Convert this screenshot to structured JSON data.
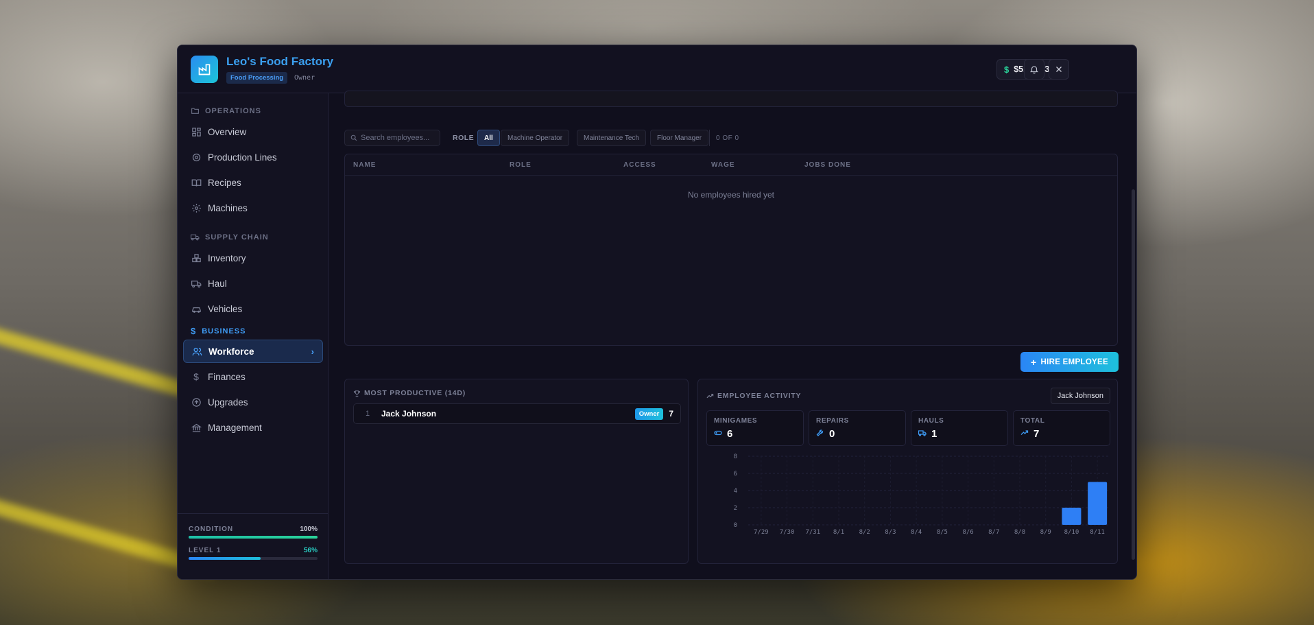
{
  "header": {
    "title": "Leo's Food Factory",
    "category": "Food Processing",
    "role": "Owner",
    "balance": "$514,433"
  },
  "sidebar": {
    "sections": [
      {
        "label": "OPERATIONS",
        "items": [
          "Overview",
          "Production Lines",
          "Recipes",
          "Machines"
        ]
      },
      {
        "label": "SUPPLY CHAIN",
        "items": [
          "Inventory",
          "Haul",
          "Vehicles"
        ]
      },
      {
        "label": "BUSINESS",
        "items": [
          "Workforce",
          "Finances",
          "Upgrades",
          "Management"
        ]
      }
    ],
    "condition_label": "CONDITION",
    "condition_value": "100%",
    "condition_fraction": 1.0,
    "level_label": "LEVEL 1",
    "level_value": "56%",
    "level_fraction": 0.56
  },
  "toolbar": {
    "search_placeholder": "Search employees...",
    "role_label": "ROLE",
    "filters": [
      "All",
      "Machine Operator",
      "Maintenance Tech",
      "Floor Manager"
    ],
    "count": "0 OF 0"
  },
  "table": {
    "headers": [
      "NAME",
      "ROLE",
      "ACCESS",
      "WAGE",
      "JOBS DONE"
    ],
    "empty_text": "No employees hired yet"
  },
  "hire_button": "HIRE EMPLOYEE",
  "most_productive": {
    "title": "MOST PRODUCTIVE (14D)",
    "rows": [
      {
        "rank": "1",
        "name": "Jack Johnson",
        "badge": "Owner",
        "count": "7"
      }
    ]
  },
  "activity": {
    "title": "EMPLOYEE ACTIVITY",
    "employee": "Jack Johnson",
    "stats": [
      {
        "label": "MINIGAMES",
        "value": "6"
      },
      {
        "label": "REPAIRS",
        "value": "0"
      },
      {
        "label": "HAULS",
        "value": "1"
      },
      {
        "label": "TOTAL",
        "value": "7"
      }
    ]
  },
  "colors": {
    "accent": "#3f9cf5",
    "teal": "#1ec0dc",
    "bar": "#2e7ff5",
    "green": "#2ad39a"
  },
  "chart_data": {
    "type": "bar",
    "categories": [
      "7/29",
      "7/30",
      "7/31",
      "8/1",
      "8/2",
      "8/3",
      "8/4",
      "8/5",
      "8/6",
      "8/7",
      "8/8",
      "8/9",
      "8/10",
      "8/11"
    ],
    "values": [
      0,
      0,
      0,
      0,
      0,
      0,
      0,
      0,
      0,
      0,
      0,
      0,
      2,
      5
    ],
    "yticks": [
      "0",
      "2",
      "4",
      "6",
      "8"
    ],
    "ylim": [
      0,
      8
    ],
    "grid": true
  }
}
